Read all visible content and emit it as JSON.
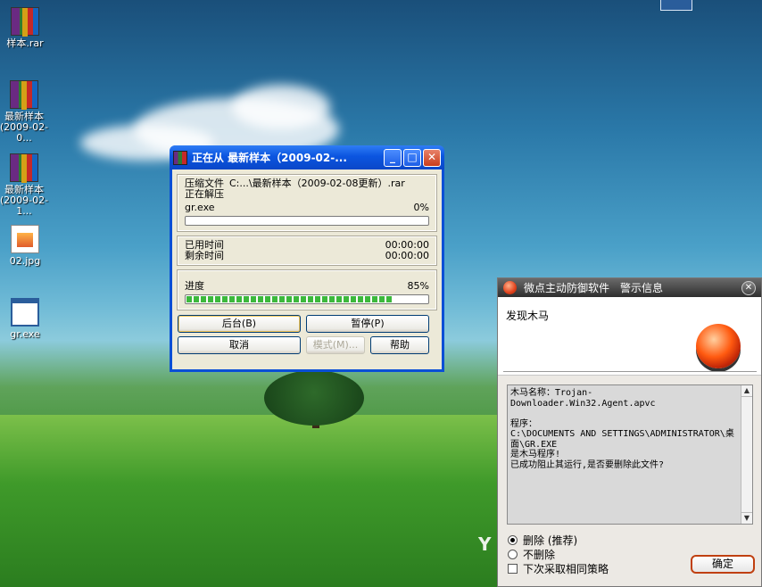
{
  "desktop": {
    "icons": [
      {
        "label": "样本.rar",
        "kind": "rar-icon"
      },
      {
        "label": "最新样本(2009-02-0...",
        "kind": "rar-icon"
      },
      {
        "label": "最新样本(2009-02-1...",
        "kind": "rar-icon"
      },
      {
        "label": "02.jpg",
        "kind": "image-file-icon"
      },
      {
        "label": "gr.exe",
        "kind": "exe-file-icon"
      }
    ]
  },
  "winrar": {
    "title": "正在从 最新样本（2009-02-...",
    "title_buttons": {
      "minimize": "_",
      "maximize": "□",
      "close": "✕"
    },
    "archive_label": "压缩文件",
    "archive_path": "C:...\\最新样本（2009-02-08更新）.rar",
    "status": "正在解压",
    "current_file": "gr.exe",
    "file_percent_text": "0%",
    "file_progress": 0,
    "elapsed_label": "已用时间",
    "elapsed_value": "00:00:00",
    "remaining_label": "剩余时间",
    "remaining_value": "00:00:00",
    "progress_label": "进度",
    "total_percent_text": "85%",
    "total_progress": 85,
    "buttons": {
      "background": "后台(B)",
      "pause": "暂停(P)",
      "cancel": "取消",
      "mode": "模式(M)...",
      "help": "帮助"
    }
  },
  "alert": {
    "title_app": "微点主动防御软件",
    "title_kind": "警示信息",
    "close_glyph": "✕",
    "found": "发现木马",
    "message": "木马名称：Trojan-\nDownloader.Win32.Agent.apvc\n\n程序：\nC:\\DOCUMENTS AND SETTINGS\\ADMINISTRATOR\\桌面\\GR.EXE\n是木马程序!\n已成功阻止其运行,是否要删除此文件?",
    "scroll_up": "▲",
    "scroll_down": "▼",
    "options": [
      {
        "label": "删除 (推荐)",
        "selected": true
      },
      {
        "label": "不删除",
        "selected": false
      }
    ],
    "remember_label": "下次采取相同策略",
    "ok_label": "确定"
  },
  "watermark": "Y"
}
